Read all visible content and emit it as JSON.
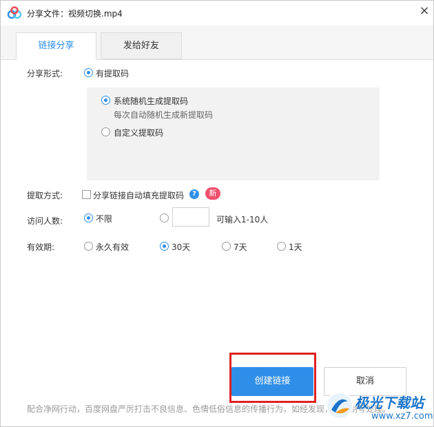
{
  "window": {
    "title": "分享文件：视频切换.mp4",
    "close_glyph": "×"
  },
  "tabs": [
    {
      "label": "链接分享",
      "active": true
    },
    {
      "label": "发给好友",
      "active": false
    }
  ],
  "share_form": {
    "label": "分享形式:",
    "option": "有提取码",
    "selected": true
  },
  "code_options": {
    "random": {
      "label": "系统随机生成提取码",
      "desc": "每次自动随机生成新提取码",
      "selected": true
    },
    "custom": {
      "label": "自定义提取码",
      "selected": false
    }
  },
  "extract_method": {
    "label": "提取方式:",
    "checkbox_label": "分享链接自动填充提取码",
    "checked": false,
    "help_glyph": "?",
    "new_badge": "新"
  },
  "visitors": {
    "label": "访问人数:",
    "unlimited_label": "不限",
    "unlimited_selected": true,
    "input_value": "",
    "input_hint": "可输入1-10人"
  },
  "validity": {
    "label": "有效期:",
    "options": [
      {
        "label": "永久有效",
        "selected": false
      },
      {
        "label": "30天",
        "selected": true
      },
      {
        "label": "7天",
        "selected": false
      },
      {
        "label": "1天",
        "selected": false
      }
    ]
  },
  "actions": {
    "create": "创建链接",
    "cancel": "取消"
  },
  "footer_note": "配合净网行动，百度网盘严厉打击不良信息、色情低俗信息的传播行为，如经发现，将限制号处理。",
  "watermark": {
    "line1": "极光下载站",
    "line2": "www.xz7.com"
  },
  "colors": {
    "accent": "#2f8fe8",
    "highlight_border": "#e02020",
    "new_badge": "#f0506e"
  }
}
